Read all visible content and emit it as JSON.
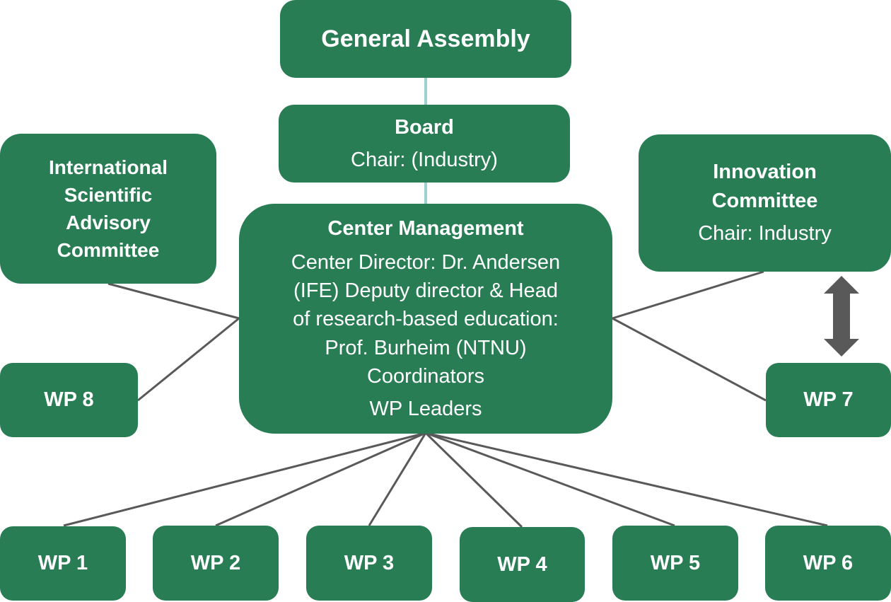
{
  "general_assembly": {
    "title": "General Assembly"
  },
  "board": {
    "title": "Board",
    "chair": "Chair: (Industry)"
  },
  "advisory": {
    "lines": [
      "International",
      "Scientific",
      "Advisory",
      "Committee"
    ]
  },
  "innovation": {
    "lines": [
      "Innovation",
      "Committee"
    ],
    "chair": "Chair: Industry"
  },
  "center": {
    "title": "Center Management",
    "lines": [
      "Center Director: Dr. Andersen",
      "(IFE) Deputy director & Head",
      "of research-based education:",
      "Prof. Burheim (NTNU)",
      "Coordinators"
    ],
    "wp_leaders": "WP Leaders"
  },
  "work_packages": [
    "WP 1",
    "WP 2",
    "WP 3",
    "WP 4",
    "WP 5",
    "WP 6",
    "WP 7",
    "WP 8"
  ],
  "colors": {
    "box": "#297d55",
    "line": "#595959",
    "top_connector": "#9dd0cf",
    "text": "#ffffff"
  }
}
